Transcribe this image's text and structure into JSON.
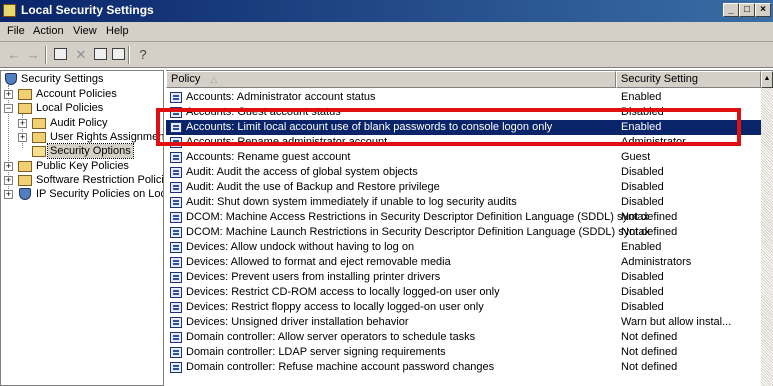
{
  "window": {
    "title": "Local Security Settings",
    "buttons": [
      "_",
      "□",
      "×"
    ]
  },
  "menu": [
    "File",
    "Action",
    "View",
    "Help"
  ],
  "toolbar": {
    "items": [
      {
        "name": "back-icon",
        "glyph": "←"
      },
      {
        "name": "forward-icon",
        "glyph": "→"
      },
      {
        "name": "up-folder-icon",
        "glyph": ""
      },
      {
        "name": "delete-icon",
        "glyph": "✕"
      },
      {
        "name": "properties-icon",
        "glyph": ""
      },
      {
        "name": "export-list-icon",
        "glyph": ""
      },
      {
        "name": "help-icon",
        "glyph": "?"
      }
    ]
  },
  "tree": {
    "root": "Security Settings",
    "account_policies": "Account Policies",
    "local_policies": "Local Policies",
    "audit_policy": "Audit Policy",
    "user_rights": "User Rights Assignmen",
    "security_options": "Security Options",
    "public_key": "Public Key Policies",
    "software_restriction": "Software Restriction Policie",
    "ip_security": "IP Security Policies on Loca"
  },
  "columns": {
    "policy": "Policy",
    "sort_indicator": "△",
    "setting": "Security Setting"
  },
  "policies": [
    {
      "name": "Accounts: Administrator account status",
      "setting": "Enabled"
    },
    {
      "name": "Accounts: Guest account status",
      "setting": "Disabled"
    },
    {
      "name": "Accounts: Limit local account use of blank passwords to console logon only",
      "setting": "Enabled",
      "selected": true
    },
    {
      "name": "Accounts: Rename administrator account",
      "setting": "Administrator"
    },
    {
      "name": "Accounts: Rename guest account",
      "setting": "Guest"
    },
    {
      "name": "Audit: Audit the access of global system objects",
      "setting": "Disabled"
    },
    {
      "name": "Audit: Audit the use of Backup and Restore privilege",
      "setting": "Disabled"
    },
    {
      "name": "Audit: Shut down system immediately if unable to log security audits",
      "setting": "Disabled"
    },
    {
      "name": "DCOM: Machine Access Restrictions in Security Descriptor Definition Language (SDDL) syntax",
      "setting": "Not defined"
    },
    {
      "name": "DCOM: Machine Launch Restrictions in Security Descriptor Definition Language (SDDL) syntax",
      "setting": "Not defined"
    },
    {
      "name": "Devices: Allow undock without having to log on",
      "setting": "Enabled"
    },
    {
      "name": "Devices: Allowed to format and eject removable media",
      "setting": "Administrators"
    },
    {
      "name": "Devices: Prevent users from installing printer drivers",
      "setting": "Disabled"
    },
    {
      "name": "Devices: Restrict CD-ROM access to locally logged-on user only",
      "setting": "Disabled"
    },
    {
      "name": "Devices: Restrict floppy access to locally logged-on user only",
      "setting": "Disabled"
    },
    {
      "name": "Devices: Unsigned driver installation behavior",
      "setting": "Warn but allow instal..."
    },
    {
      "name": "Domain controller: Allow server operators to schedule tasks",
      "setting": "Not defined"
    },
    {
      "name": "Domain controller: LDAP server signing requirements",
      "setting": "Not defined"
    },
    {
      "name": "Domain controller: Refuse machine account password changes",
      "setting": "Not defined"
    }
  ],
  "colors": {
    "title_bar": "#0a246a",
    "selection": "#0a246a",
    "annotation_box": "#e01010"
  }
}
